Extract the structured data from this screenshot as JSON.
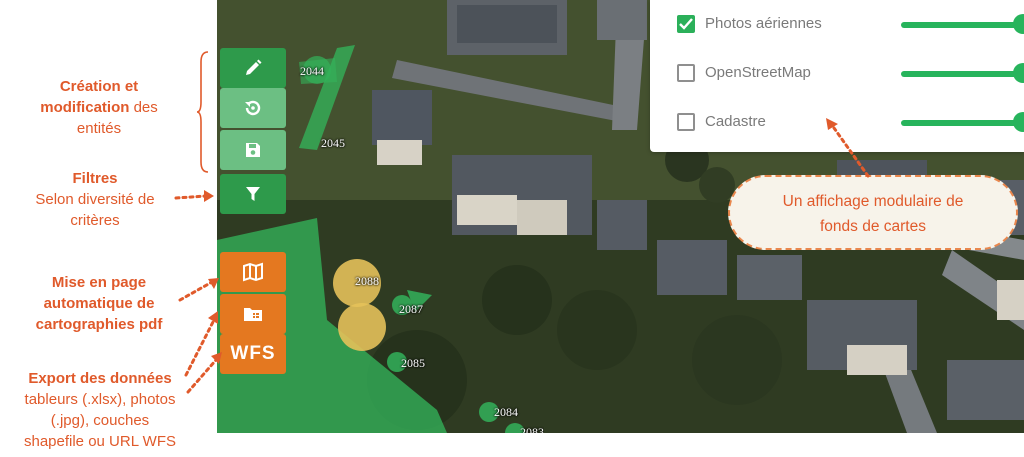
{
  "annotations": {
    "creation": {
      "bold1": "Création et",
      "bold2": "modification",
      "rest2": " des",
      "line3": "entités"
    },
    "filtres": {
      "title": "Filtres",
      "line2": "Selon diversité de",
      "line3": "critères"
    },
    "mise_en_page": {
      "line1": "Mise en page",
      "line2": "automatique de",
      "line3": "cartographies pdf"
    },
    "export": {
      "title": "Export des données",
      "line2": "tableurs (.xlsx), photos",
      "line3": "(.jpg), couches",
      "line4": "shapefile ou URL WFS"
    }
  },
  "toolbar": {
    "buttons": [
      {
        "name": "edit-button",
        "icon": "pencil-icon"
      },
      {
        "name": "history-button",
        "icon": "history-icon"
      },
      {
        "name": "save-button",
        "icon": "floppy-icon"
      },
      {
        "name": "filter-button",
        "icon": "funnel-icon"
      },
      {
        "name": "print-map-button",
        "icon": "map-icon"
      },
      {
        "name": "export-table-button",
        "icon": "folder-table-icon"
      },
      {
        "name": "wfs-button",
        "label": "WFS"
      }
    ]
  },
  "map": {
    "labels": [
      "2044",
      "2045",
      "2088",
      "2087",
      "2085",
      "2084",
      "2083"
    ]
  },
  "layers": [
    {
      "name": "Photos aériennes",
      "checked": true,
      "opacity": 1.0
    },
    {
      "name": "OpenStreetMap",
      "checked": false,
      "opacity": 1.0
    },
    {
      "name": "Cadastre",
      "checked": false,
      "opacity": 1.0
    }
  ],
  "callout": {
    "line1": "Un affichage modulaire de",
    "line2": "fonds de cartes"
  },
  "colors": {
    "accent_orange": "#e05a2b",
    "tool_green": "#2e9a4b",
    "tool_orange": "#e47820",
    "slider_green": "#27b45c"
  }
}
